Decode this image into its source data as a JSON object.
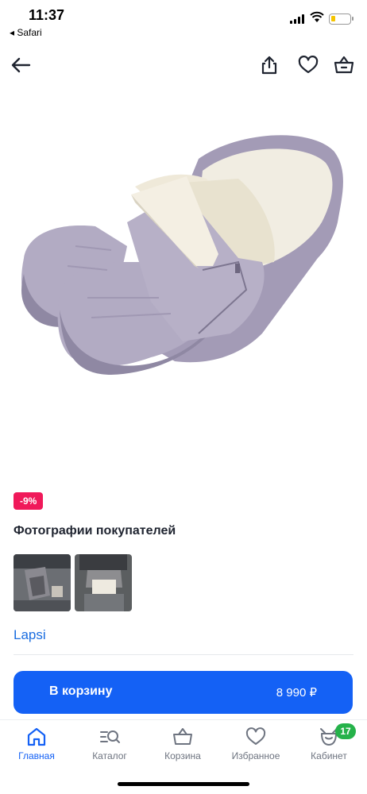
{
  "status": {
    "time": "11:37",
    "back_app": "◂ Safari"
  },
  "product": {
    "discount": "-9%",
    "brand": "Lapsi"
  },
  "section": {
    "customer_photos_title": "Фотографии покупателей"
  },
  "cart_button": {
    "label": "В корзину",
    "price": "8 990 ₽"
  },
  "tabbar": {
    "items": [
      {
        "label": "Главная",
        "icon": "home-icon",
        "active": true
      },
      {
        "label": "Каталог",
        "icon": "catalog-search-icon",
        "active": false
      },
      {
        "label": "Корзина",
        "icon": "basket-icon",
        "active": false
      },
      {
        "label": "Избранное",
        "icon": "heart-icon",
        "active": false
      },
      {
        "label": "Кабинет",
        "icon": "profile-icon",
        "active": false
      }
    ],
    "cabinet_badge": "17"
  },
  "colors": {
    "accent": "#1461f5",
    "discount": "#f0195a",
    "badge": "#25b24a",
    "link": "#1a6de0"
  }
}
